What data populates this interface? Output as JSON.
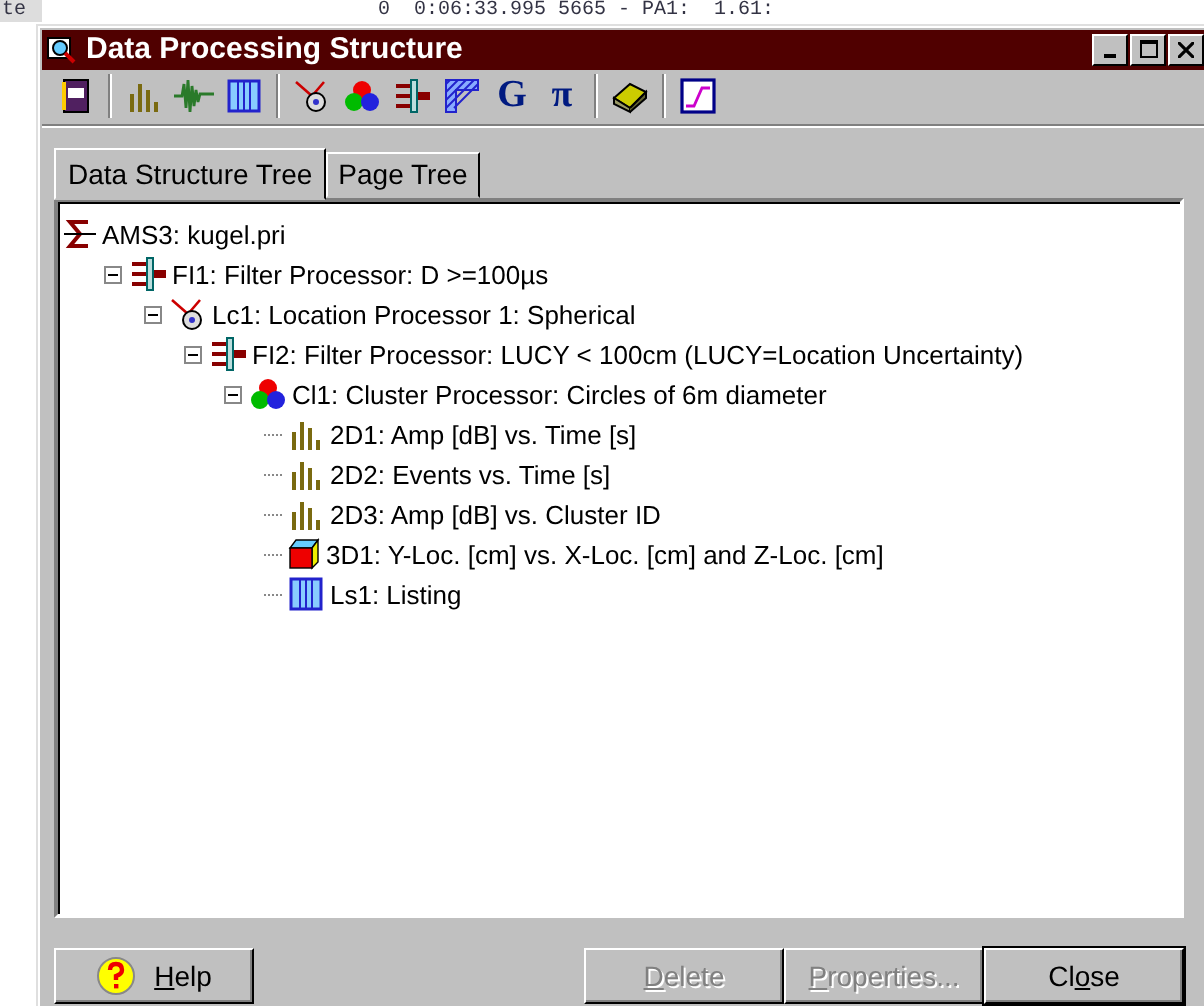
{
  "background_app": {
    "left_text": "te",
    "status_text": "0  0:06:33.995 5665 - PA1:  1.61:"
  },
  "window": {
    "title": "Data Processing Structure"
  },
  "toolbar": {
    "letters": [
      "G",
      "π"
    ]
  },
  "tabs": [
    {
      "label": "Data Structure Tree",
      "selected": true
    },
    {
      "label": "Page Tree",
      "selected": false
    }
  ],
  "tree": [
    {
      "kind": "source",
      "label": "AMS3: kugel.pri",
      "children": [
        {
          "kind": "filter",
          "label": "FI1: Filter Processor:  D >=100µs",
          "expanded": true,
          "children": [
            {
              "kind": "location",
              "label": "Lc1: Location Processor 1: Spherical",
              "expanded": true,
              "children": [
                {
                  "kind": "filter",
                  "label": "FI2: Filter Processor: LUCY < 100cm (LUCY=Location Uncertainty)",
                  "expanded": true,
                  "children": [
                    {
                      "kind": "cluster",
                      "label": "Cl1: Cluster Processor: Circles of 6m diameter",
                      "expanded": true,
                      "children": [
                        {
                          "kind": "chart2d",
                          "label": "2D1: Amp [dB] vs. Time [s]"
                        },
                        {
                          "kind": "chart2d",
                          "label": "2D2: Events vs. Time [s]"
                        },
                        {
                          "kind": "chart2d",
                          "label": "2D3: Amp [dB] vs. Cluster ID"
                        },
                        {
                          "kind": "chart3d",
                          "label": "3D1: Y-Loc. [cm] vs. X-Loc. [cm] and Z-Loc. [cm]"
                        },
                        {
                          "kind": "listing",
                          "label": "Ls1: Listing"
                        }
                      ]
                    }
                  ]
                }
              ]
            }
          ]
        }
      ]
    }
  ],
  "buttons": [
    {
      "kind": "help",
      "accel": "H",
      "after": "elp",
      "disabled": false,
      "default": false
    },
    {
      "kind": "plain",
      "accel": "D",
      "after": "elete",
      "disabled": true,
      "default": false
    },
    {
      "kind": "plain",
      "accel": "P",
      "after": "roperties...",
      "disabled": true,
      "default": false
    },
    {
      "kind": "plain",
      "before": "Cl",
      "accel": "o",
      "after": "se",
      "disabled": false,
      "default": true
    }
  ]
}
